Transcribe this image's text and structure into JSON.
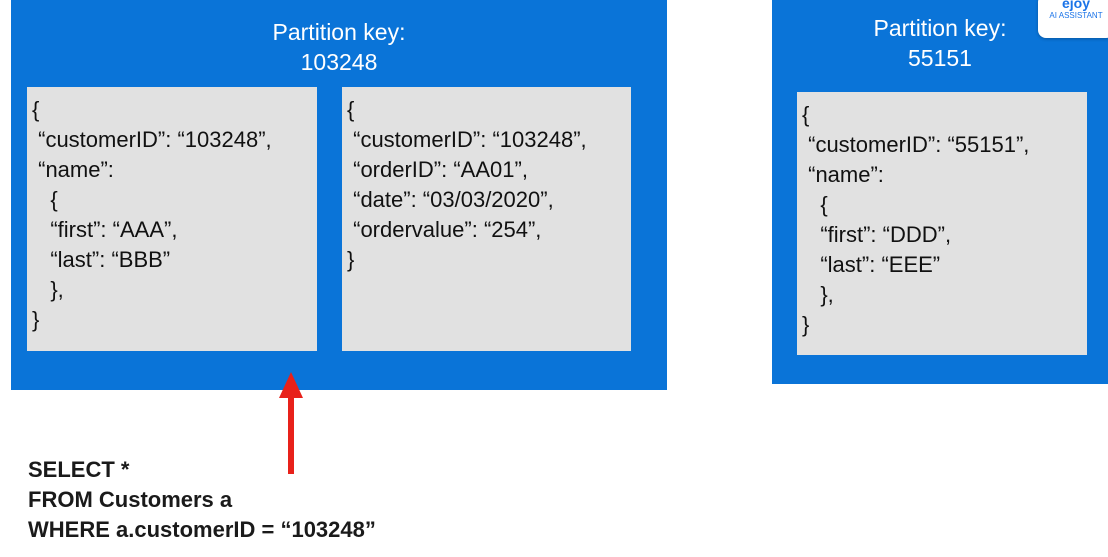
{
  "partitions": [
    {
      "label": "Partition key:",
      "key": "103248",
      "documents": [
        {
          "lines": [
            "{",
            " “customerID”: “103248”,",
            " “name”:",
            "   {",
            "   “first”: “AAA”,",
            "   “last”: “BBB”",
            "   },",
            "}"
          ]
        },
        {
          "lines": [
            "{",
            " “customerID”: “103248”,",
            " “orderID”: “AA01”,",
            " “date”: “03/03/2020”,",
            " “ordervalue”: “254”,",
            "}"
          ]
        }
      ]
    },
    {
      "label": "Partition key:",
      "key": "55151",
      "documents": [
        {
          "lines": [
            "{",
            " “customerID”: “55151”,",
            " “name”:",
            "   {",
            "   “first”: “DDD”,",
            "   “last”: “EEE”",
            "   },",
            "}"
          ]
        }
      ]
    }
  ],
  "query": {
    "lines": [
      "SELECT *",
      "FROM Customers a",
      "WHERE a.customerID = “103248”"
    ]
  },
  "arrow_color": "#e8211a",
  "partition_color": "#0a74d8",
  "document_color": "#e1e1e1",
  "badge": {
    "logo": "ejoy",
    "subtitle": "AI ASSISTANT"
  }
}
